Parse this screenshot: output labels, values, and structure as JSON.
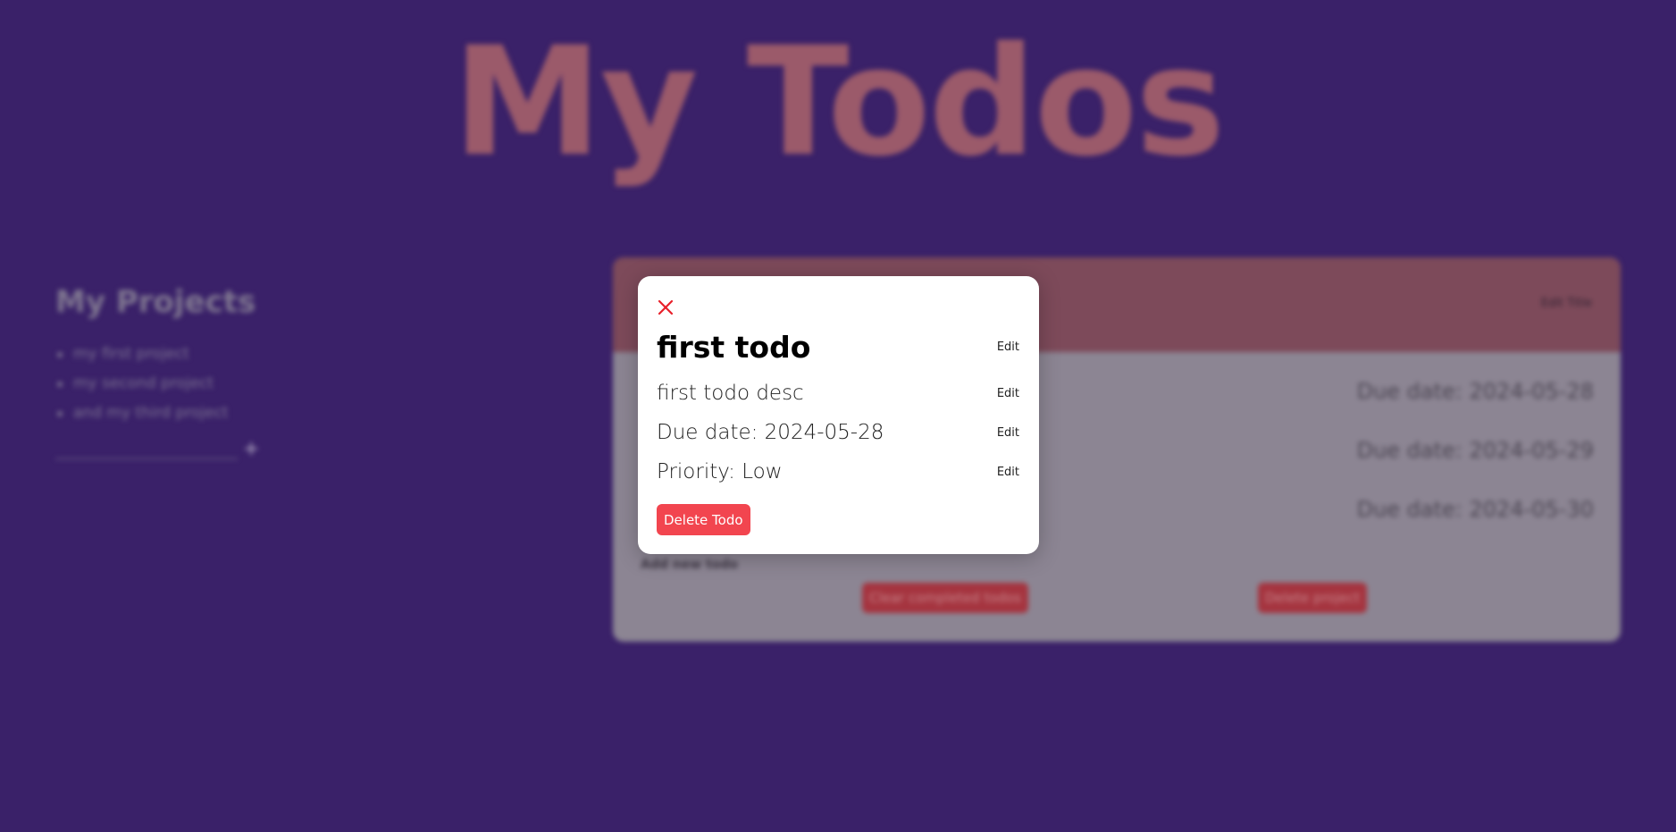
{
  "app": {
    "title": "My Todos"
  },
  "sidebar": {
    "heading": "My Projects",
    "projects": [
      {
        "label": "my first project"
      },
      {
        "label": "my second project"
      },
      {
        "label": "and my third project"
      }
    ],
    "new_project_value": "",
    "add_icon": "plus-icon"
  },
  "project_panel": {
    "edit_title_label": "Edit Title",
    "todos": [
      {
        "due": "Due date: 2024-05-28"
      },
      {
        "due": "Due date: 2024-05-29"
      },
      {
        "due": "Due date: 2024-05-30"
      }
    ],
    "add_todo_label": "Add new todo",
    "clear_completed_label": "Clear completed todos",
    "delete_project_label": "Delete project"
  },
  "modal": {
    "close_icon": "close-icon",
    "title": "first todo",
    "description": "first todo desc",
    "due_date": "Due date: 2024-05-28",
    "priority": "Priority: Low",
    "edit_label": "Edit",
    "delete_label": "Delete Todo"
  },
  "colors": {
    "background": "#3a2169",
    "modal_bg": "#ffffff",
    "close_icon": "#e8202a",
    "delete_button": "#f2454f"
  }
}
